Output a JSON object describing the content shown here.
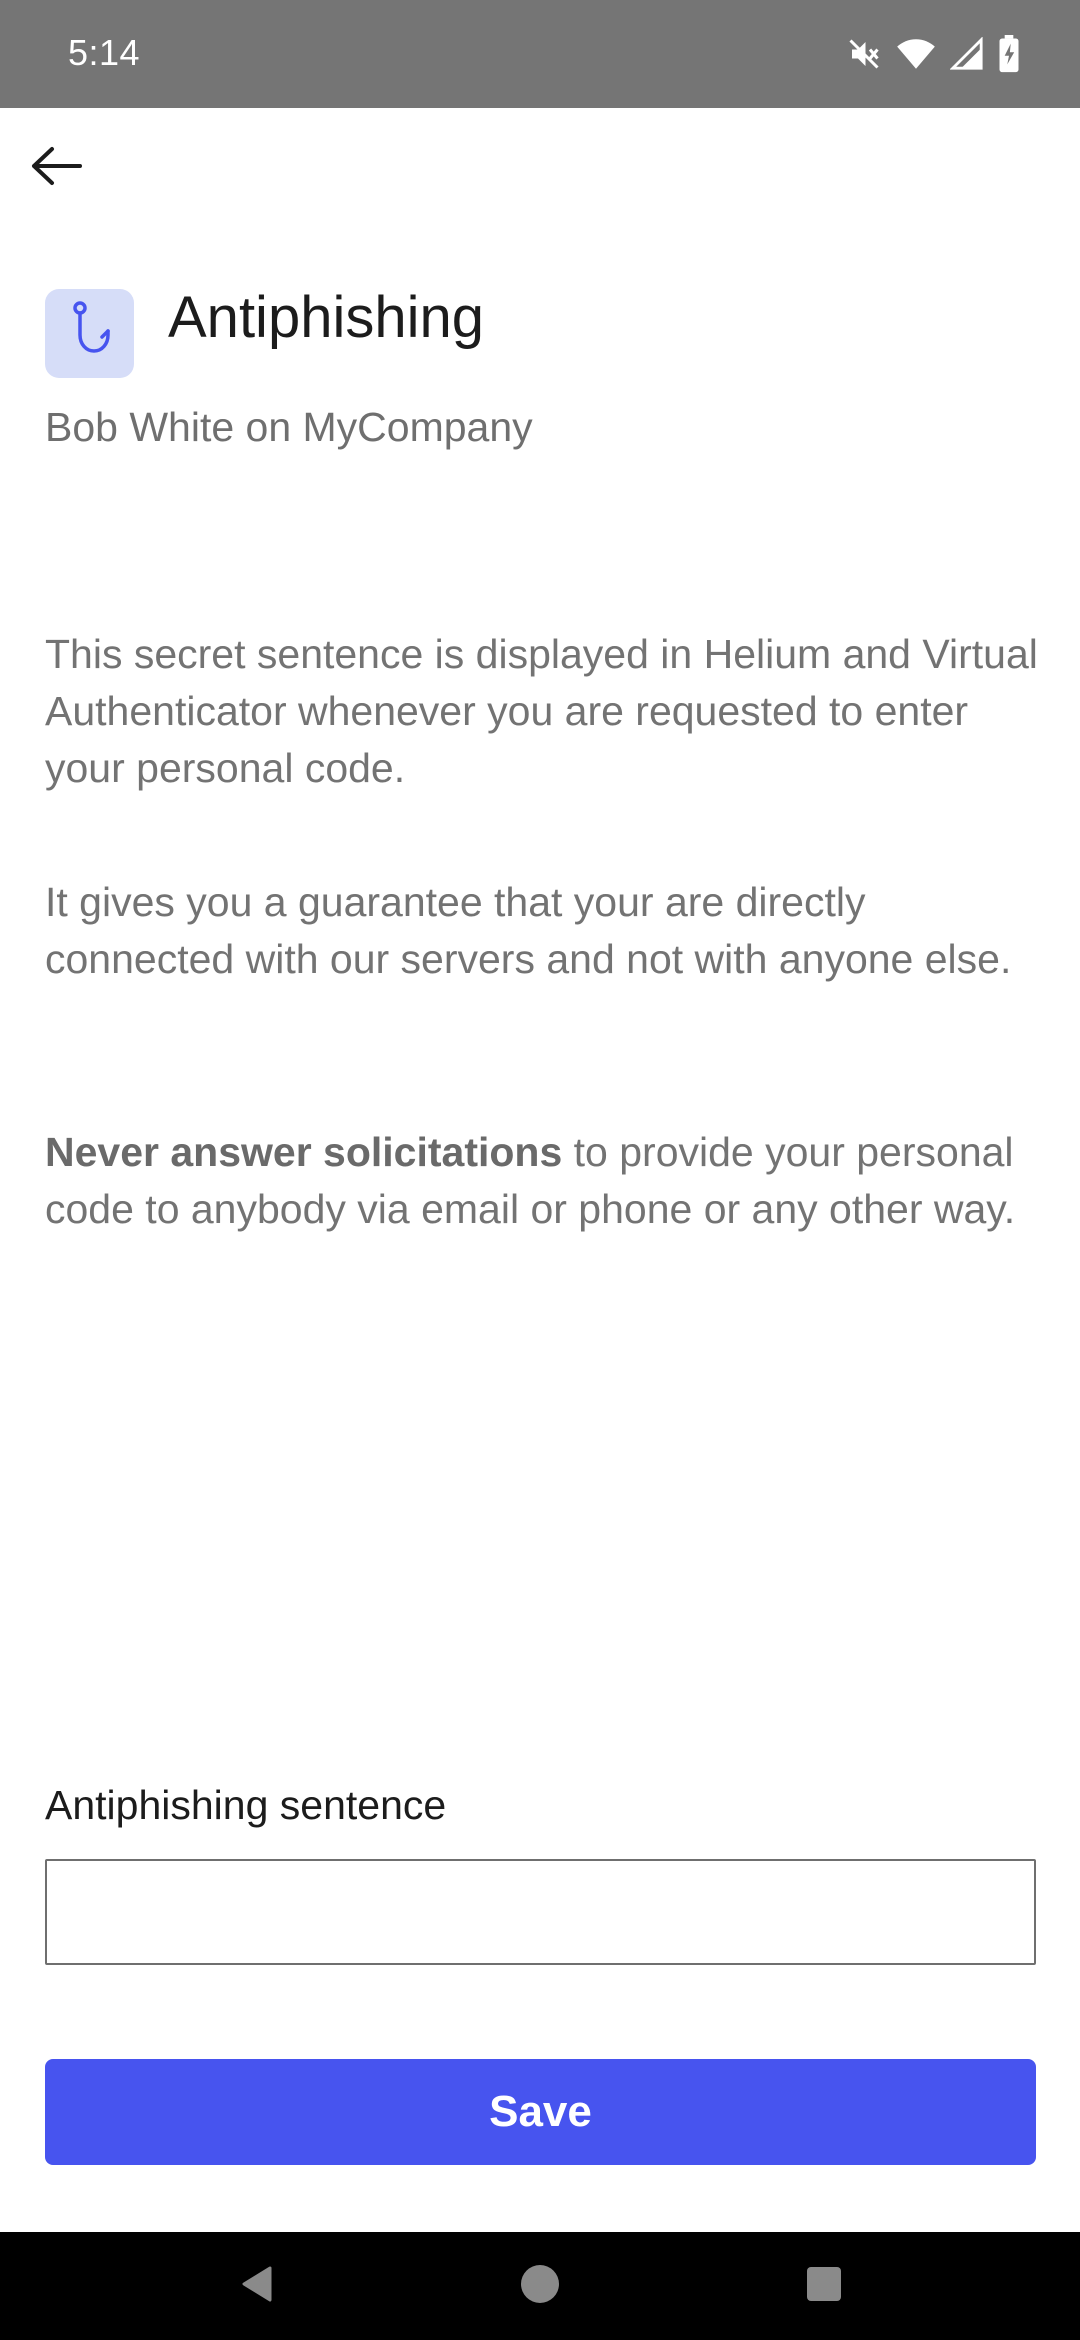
{
  "status_bar": {
    "time": "5:14",
    "icons": [
      "mute-icon",
      "wifi-icon",
      "signal-icon",
      "battery-charging-icon"
    ]
  },
  "header": {
    "back_icon": "arrow-left-icon",
    "icon": "fishing-hook-icon",
    "title": "Antiphishing",
    "subtitle": "Bob White on MyCompany"
  },
  "content": {
    "paragraph1": "This secret sentence is displayed in Helium and Virtual Authenticator whenever you are requested to enter your personal code.",
    "paragraph2": "It gives you a guarantee that your are directly connected with our servers and not with anyone else.",
    "paragraph3_bold": "Never answer solicitations",
    "paragraph3_rest": " to provide your personal code to anybody via email or phone or any other way."
  },
  "form": {
    "field_label": "Antiphishing sentence",
    "field_value": "",
    "save_label": "Save"
  },
  "colors": {
    "accent": "#4754ef",
    "icon_bg": "#d6ddf8",
    "status_bar": "#757575"
  },
  "nav_bar": {
    "icons": [
      "nav-back-icon",
      "nav-home-icon",
      "nav-recents-icon"
    ]
  }
}
